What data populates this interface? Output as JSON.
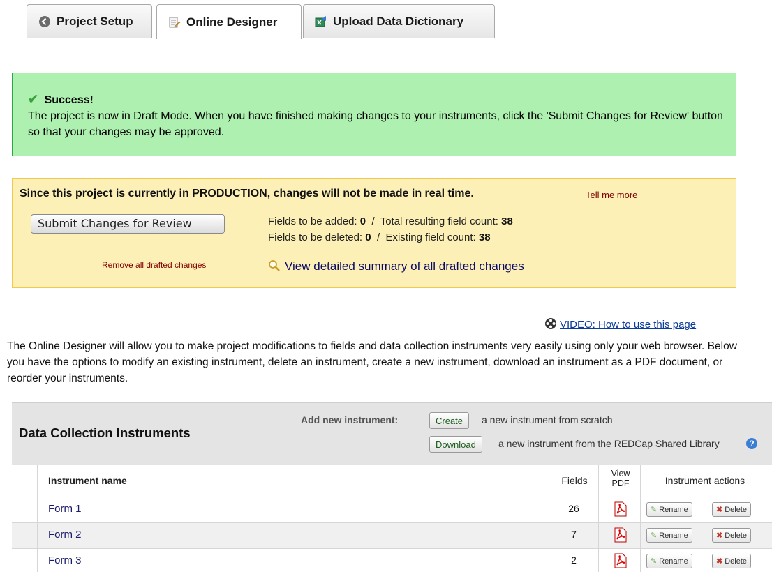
{
  "tabs": [
    {
      "label": "Project Setup",
      "icon": "back-arrow-icon"
    },
    {
      "label": "Online Designer",
      "icon": "pencil-form-icon",
      "active": true
    },
    {
      "label": "Upload Data Dictionary",
      "icon": "spreadsheet-icon"
    }
  ],
  "success": {
    "title": "Success!",
    "message": "The project is now in Draft Mode. When you have finished making changes to your instruments, click the 'Submit Changes for Review' button so that your changes may be approved.",
    "color": "#aef0b0"
  },
  "production": {
    "heading": "Since this project is currently in PRODUCTION, changes will not be made in real time.",
    "tell_me_more": "Tell me more",
    "submit_label": "Submit Changes for Review",
    "added_label": "Fields to be added:",
    "added_value": "0",
    "total_label": "Total resulting field count:",
    "total_value": "38",
    "deleted_label": "Fields to be deleted:",
    "deleted_value": "0",
    "existing_label": "Existing field count:",
    "existing_value": "38",
    "remove_label": "Remove all drafted changes",
    "view_summary_label": "View detailed summary of all drafted changes",
    "color": "#fdf0b6"
  },
  "video_link": "VIDEO: How to use this page",
  "description": "The Online Designer will allow you to make project modifications to fields and data collection instruments very easily using only your web browser. Below you have the options to modify an existing instrument, delete an instrument, create a new instrument, download an instrument as a PDF document, or reorder your instruments.",
  "instruments": {
    "title": "Data Collection Instruments",
    "add_label": "Add new instrument:",
    "create_label": "Create",
    "create_text": "a new instrument from scratch",
    "download_label": "Download",
    "download_text": "a new instrument from the REDCap Shared Library",
    "columns": {
      "name": "Instrument name",
      "fields": "Fields",
      "pdf": "View PDF",
      "actions": "Instrument actions"
    },
    "rename_label": "Rename",
    "delete_label": "Delete",
    "rows": [
      {
        "name": "Form 1",
        "fields": "26"
      },
      {
        "name": "Form 2",
        "fields": "7"
      },
      {
        "name": "Form 3",
        "fields": "2"
      }
    ]
  }
}
